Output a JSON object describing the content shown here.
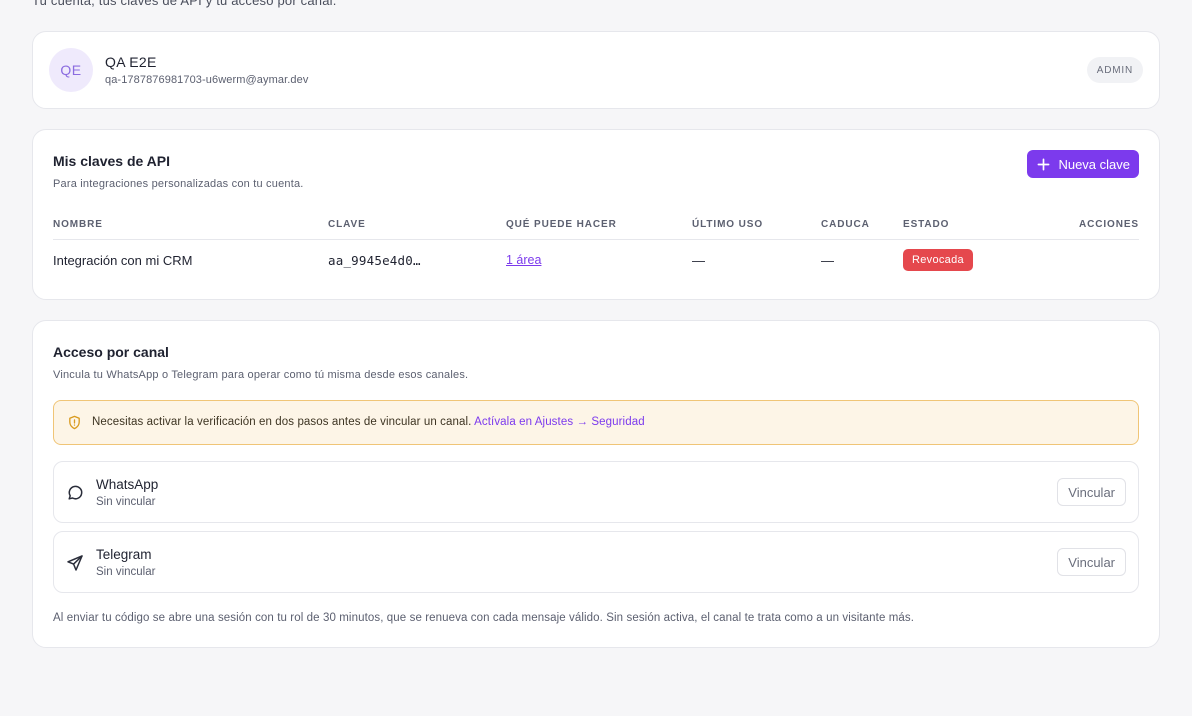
{
  "intro": "Tu cuenta, tus claves de API y tu acceso por canal.",
  "profile": {
    "initials": "QE",
    "name": "QA E2E",
    "email": "qa-1787876981703-u6werm@aymar.dev",
    "role": "ADMIN"
  },
  "api_keys": {
    "title": "Mis claves de API",
    "subtitle": "Para integraciones personalizadas con tu cuenta.",
    "new_button": "Nueva clave",
    "columns": [
      "Nombre",
      "Clave",
      "Qué puede hacer",
      "Último uso",
      "Caduca",
      "Estado",
      "Acciones"
    ],
    "rows": [
      {
        "name": "Integración con mi CRM",
        "key": "aa_9945e4d0…",
        "scope": "1 área",
        "last_used": "—",
        "expires": "—",
        "status": "Revocada"
      }
    ]
  },
  "channels": {
    "title": "Acceso por canal",
    "subtitle": "Vincula tu WhatsApp o Telegram para operar como tú misma desde esos canales.",
    "alert_text": "Necesitas activar la verificación en dos pasos antes de vincular un canal.",
    "alert_link": "Actívala en Ajustes → Seguridad",
    "items": [
      {
        "name": "WhatsApp",
        "status": "Sin vincular",
        "action": "Vincular",
        "icon": "message-circle-icon"
      },
      {
        "name": "Telegram",
        "status": "Sin vincular",
        "action": "Vincular",
        "icon": "send-icon"
      }
    ],
    "footnote": "Al enviar tu código se abre una sesión con tu rol de 30 minutos, que se renueva con cada mensaje válido. Sin sesión activa, el canal te trata como a un visitante más."
  },
  "colors": {
    "accent": "#7c3aed",
    "danger": "#e5484d",
    "warning_bg": "#fdf5e7",
    "warning_border": "#f0c577"
  }
}
